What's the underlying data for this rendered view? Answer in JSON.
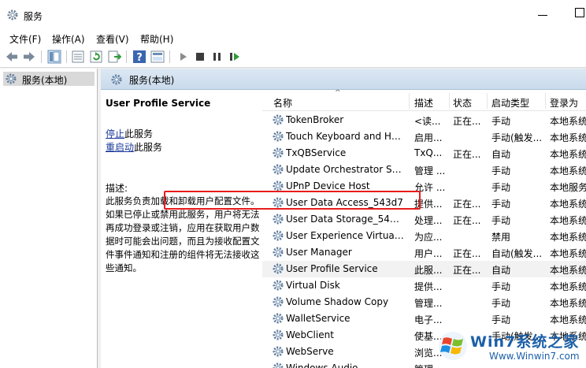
{
  "window": {
    "title": "服务"
  },
  "menu": [
    "文件(F)",
    "操作(A)",
    "查看(V)",
    "帮助(H)"
  ],
  "toolbar_icons": [
    "back-icon",
    "forward-icon",
    "show-hide-tree-icon",
    "properties-icon",
    "refresh-icon",
    "export-icon",
    "help-icon",
    "view-icon",
    "start-icon",
    "stop-icon",
    "pause-icon",
    "restart-icon"
  ],
  "tree": {
    "root": "服务(本地)"
  },
  "pane": {
    "header": "服务(本地)",
    "selected_title": "User Profile Service",
    "stop_link": "停止",
    "stop_suffix": "此服务",
    "restart_link": "重启动",
    "restart_suffix": "此服务",
    "desc_label": "描述:",
    "desc_text": "此服务负责加载和卸载用户配置文件。如果已停止或禁用此服务，用户将无法再成功登录或注销，应用在获取用户数据时可能会出问题，而且为接收配置文件事件通知和注册的组件将无法接收这些通知。"
  },
  "columns": {
    "name": "名称",
    "desc": "描述",
    "status": "状态",
    "start": "启动类型",
    "logon": "登录为"
  },
  "rows": [
    {
      "name": "TokenBroker",
      "desc": "<读...",
      "status": "正在...",
      "start": "手动",
      "logon": "本地系统"
    },
    {
      "name": "Touch Keyboard and Ha...",
      "desc": "启用...",
      "status": "",
      "start": "手动(触发...",
      "logon": "本地系统"
    },
    {
      "name": "TxQBService",
      "desc": "TxQ...",
      "status": "正在...",
      "start": "自动",
      "logon": "本地系统"
    },
    {
      "name": "Update Orchestrator Ser...",
      "desc": "管理 ...",
      "status": "",
      "start": "手动",
      "logon": "本地系统"
    },
    {
      "name": "UPnP Device Host",
      "desc": "允许 ...",
      "status": "",
      "start": "手动",
      "logon": "本地服务"
    },
    {
      "name": "User Data Access_543d7",
      "desc": "提供...",
      "status": "正在...",
      "start": "手动",
      "logon": "本地系统"
    },
    {
      "name": "User Data Storage_543d7",
      "desc": "处理...",
      "status": "正在...",
      "start": "手动",
      "logon": "本地系统"
    },
    {
      "name": "User Experience Virtualiz...",
      "desc": "为应...",
      "status": "",
      "start": "禁用",
      "logon": "本地系统"
    },
    {
      "name": "User Manager",
      "desc": "用户...",
      "status": "正在...",
      "start": "自动(触发...",
      "logon": "本地系统"
    },
    {
      "name": "User Profile Service",
      "desc": "此服...",
      "status": "正在...",
      "start": "自动",
      "logon": "本地系统"
    },
    {
      "name": "Virtual Disk",
      "desc": "提供...",
      "status": "",
      "start": "手动",
      "logon": "本地系统"
    },
    {
      "name": "Volume Shadow Copy",
      "desc": "管理...",
      "status": "",
      "start": "手动",
      "logon": "本地系统"
    },
    {
      "name": "WalletService",
      "desc": "电子...",
      "status": "",
      "start": "手动",
      "logon": "本地系统"
    },
    {
      "name": "WebClient",
      "desc": "使基...",
      "status": "",
      "start": "手动(触发...",
      "logon": "本地系统"
    },
    {
      "name": "WebServe",
      "desc": "浏览...",
      "status": "",
      "start": "",
      "logon": ""
    },
    {
      "name": "Windows Audio",
      "desc": "管理...",
      "status": "",
      "start": "",
      "logon": ""
    }
  ],
  "selected_index": 9,
  "watermark": {
    "text": "Win7系统之家",
    "url": "Www.Winwin7.com"
  }
}
